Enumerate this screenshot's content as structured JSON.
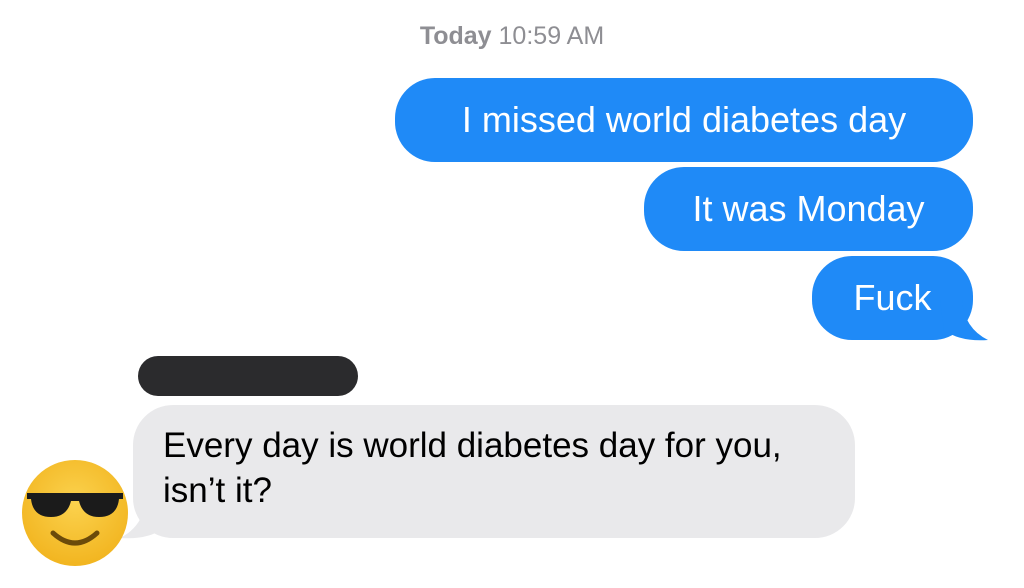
{
  "timestamp": {
    "day": "Today",
    "time": "10:59 AM"
  },
  "sent_messages": [
    {
      "text": "I missed world diabetes day"
    },
    {
      "text": "It was Monday"
    },
    {
      "text": "Fuck"
    }
  ],
  "received_message": {
    "text": "Every day is world diabetes day for you, isn’t it?"
  },
  "contact": {
    "avatar_icon": "sunglasses-emoji-icon",
    "name_redacted": true
  },
  "colors": {
    "sent_bubble": "#1f8af7",
    "received_bubble": "#e9e9eb",
    "redaction": "#2b2b2d",
    "timestamp": "#8e8e93"
  }
}
